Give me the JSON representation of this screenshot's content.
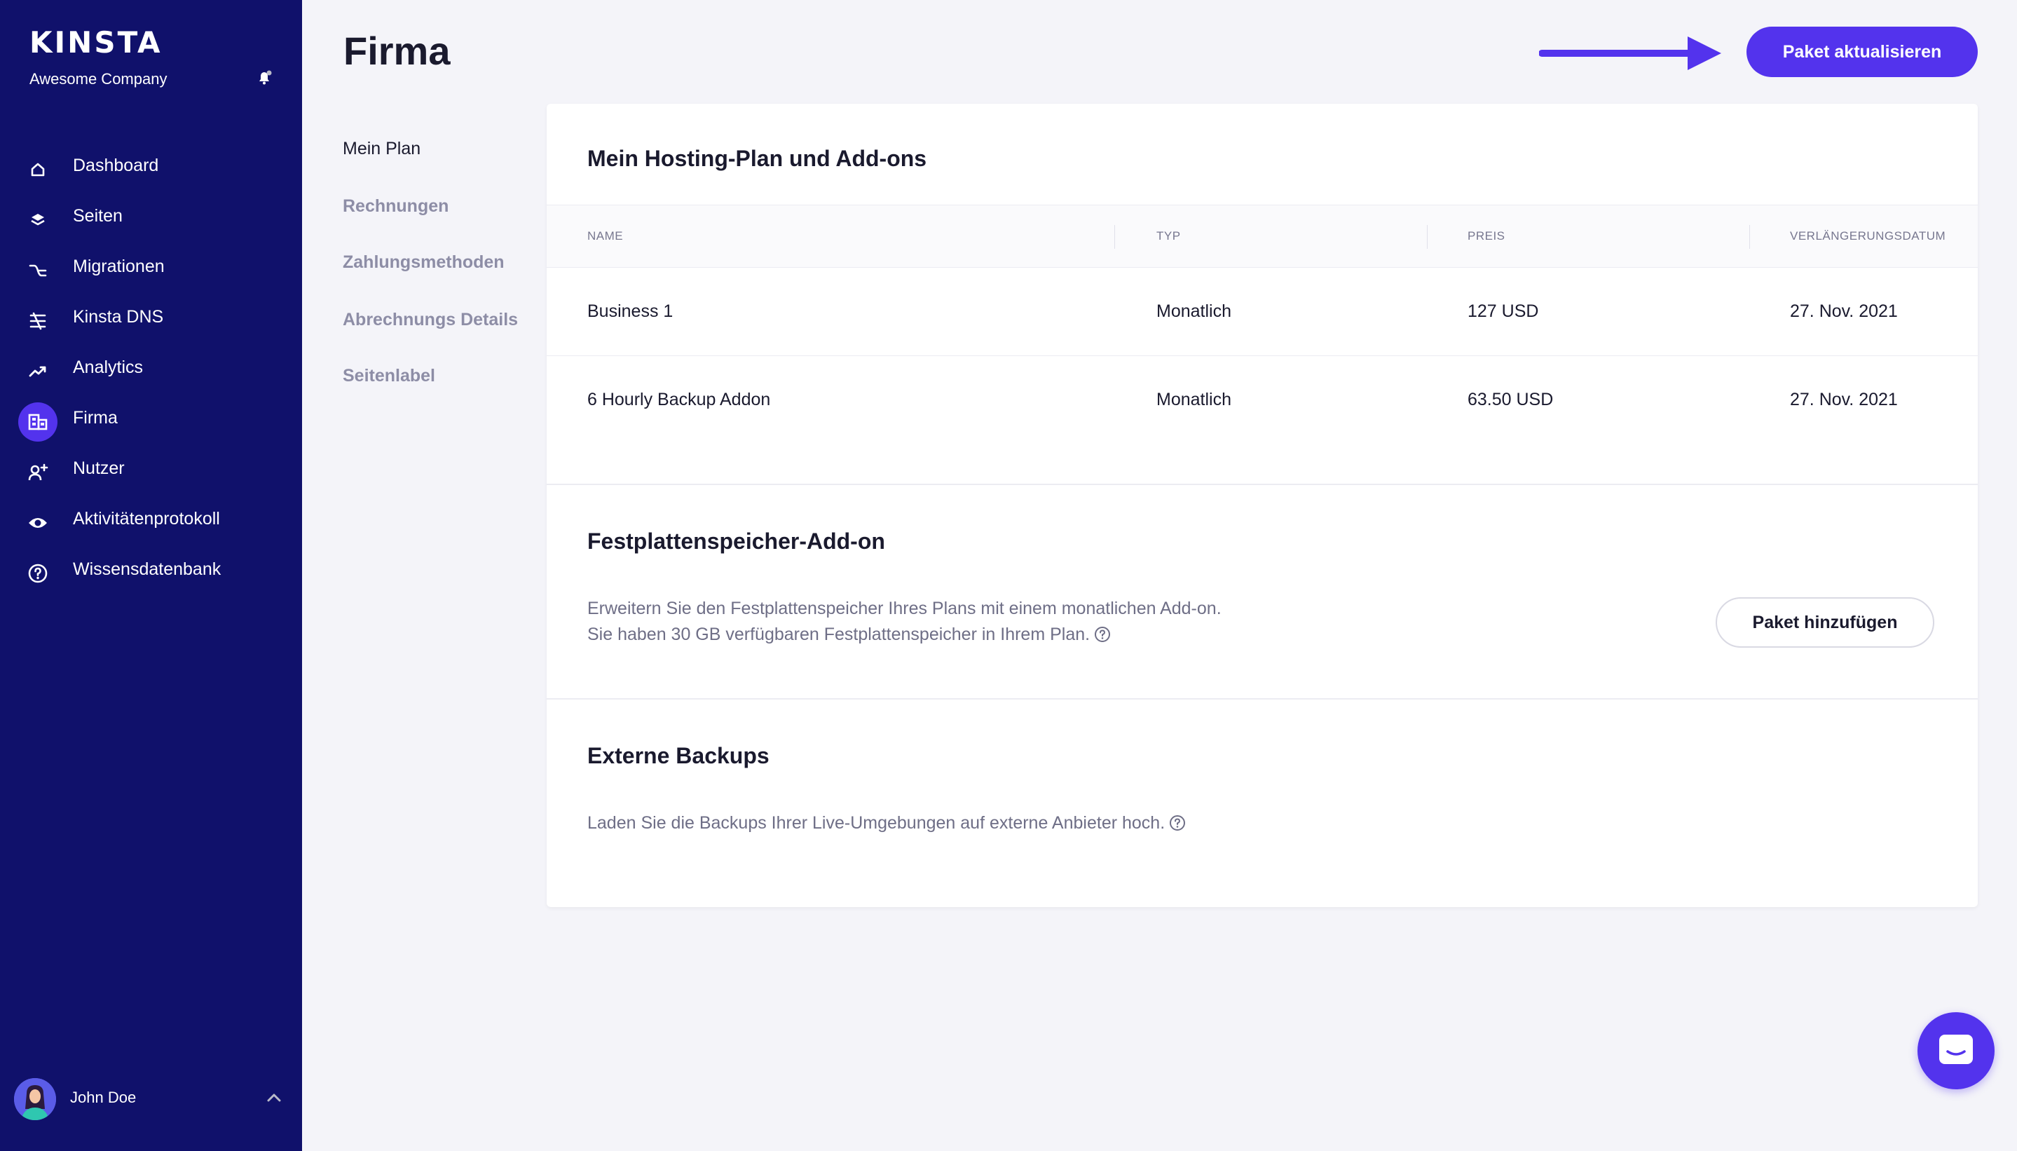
{
  "brand": {
    "logo": "KINSTA",
    "company": "Awesome Company"
  },
  "colors": {
    "sidebar": "#10116b",
    "accent": "#5333ed",
    "background": "#f4f4f9"
  },
  "nav": {
    "items": [
      {
        "label": "Dashboard",
        "icon": "home-icon",
        "active": false
      },
      {
        "label": "Seiten",
        "icon": "layers-icon",
        "active": false
      },
      {
        "label": "Migrationen",
        "icon": "migration-icon",
        "active": false
      },
      {
        "label": "Kinsta DNS",
        "icon": "dns-icon",
        "active": false
      },
      {
        "label": "Analytics",
        "icon": "trend-icon",
        "active": false
      },
      {
        "label": "Firma",
        "icon": "building-icon",
        "active": true
      },
      {
        "label": "Nutzer",
        "icon": "add-user-icon",
        "active": false
      },
      {
        "label": "Aktivitätenprotokoll",
        "icon": "eye-icon",
        "active": false
      },
      {
        "label": "Wissensdatenbank",
        "icon": "help-circle-icon",
        "active": false
      }
    ]
  },
  "user": {
    "name": "John Doe"
  },
  "header": {
    "title": "Firma",
    "upgrade_label": "Paket aktualisieren"
  },
  "subnav": {
    "items": [
      {
        "label": "Mein Plan",
        "active": true
      },
      {
        "label": "Rechnungen",
        "active": false
      },
      {
        "label": "Zahlungsmethoden",
        "active": false
      },
      {
        "label": "Abrechnungs Details",
        "active": false
      },
      {
        "label": "Seitenlabel",
        "active": false
      }
    ]
  },
  "plan": {
    "title": "Mein Hosting-Plan und Add-ons",
    "columns": [
      "NAME",
      "TYP",
      "PREIS",
      "VERLÄNGERUNGSDATUM"
    ],
    "rows": [
      {
        "name": "Business 1",
        "type": "Monatlich",
        "price": "127 USD",
        "renewal": "27. Nov. 2021"
      },
      {
        "name": "6 Hourly Backup Addon",
        "type": "Monatlich",
        "price": "63.50 USD",
        "renewal": "27. Nov. 2021"
      }
    ]
  },
  "disk": {
    "title": "Festplattenspeicher-Add-on",
    "line1": "Erweitern Sie den Festplattenspeicher Ihres Plans mit einem monatlichen Add-on.",
    "line2": "Sie haben 30 GB verfügbaren Festplattenspeicher in Ihrem Plan.",
    "button": "Paket hinzufügen"
  },
  "backups": {
    "title": "Externe Backups",
    "text": "Laden Sie die Backups Ihrer Live-Umgebungen auf externe Anbieter hoch."
  }
}
